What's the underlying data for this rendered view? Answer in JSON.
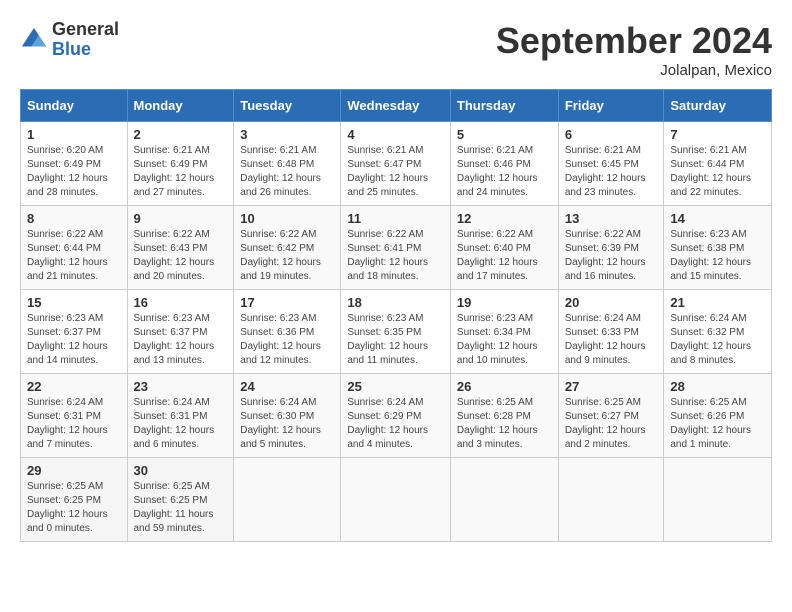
{
  "logo": {
    "general": "General",
    "blue": "Blue"
  },
  "title": "September 2024",
  "location": "Jolalpan, Mexico",
  "days_header": [
    "Sunday",
    "Monday",
    "Tuesday",
    "Wednesday",
    "Thursday",
    "Friday",
    "Saturday"
  ],
  "weeks": [
    [
      {
        "day": "1",
        "sunrise": "6:20 AM",
        "sunset": "6:49 PM",
        "daylight": "12 hours and 28 minutes."
      },
      {
        "day": "2",
        "sunrise": "6:21 AM",
        "sunset": "6:49 PM",
        "daylight": "12 hours and 27 minutes."
      },
      {
        "day": "3",
        "sunrise": "6:21 AM",
        "sunset": "6:48 PM",
        "daylight": "12 hours and 26 minutes."
      },
      {
        "day": "4",
        "sunrise": "6:21 AM",
        "sunset": "6:47 PM",
        "daylight": "12 hours and 25 minutes."
      },
      {
        "day": "5",
        "sunrise": "6:21 AM",
        "sunset": "6:46 PM",
        "daylight": "12 hours and 24 minutes."
      },
      {
        "day": "6",
        "sunrise": "6:21 AM",
        "sunset": "6:45 PM",
        "daylight": "12 hours and 23 minutes."
      },
      {
        "day": "7",
        "sunrise": "6:21 AM",
        "sunset": "6:44 PM",
        "daylight": "12 hours and 22 minutes."
      }
    ],
    [
      {
        "day": "8",
        "sunrise": "6:22 AM",
        "sunset": "6:44 PM",
        "daylight": "12 hours and 21 minutes."
      },
      {
        "day": "9",
        "sunrise": "6:22 AM",
        "sunset": "6:43 PM",
        "daylight": "12 hours and 20 minutes."
      },
      {
        "day": "10",
        "sunrise": "6:22 AM",
        "sunset": "6:42 PM",
        "daylight": "12 hours and 19 minutes."
      },
      {
        "day": "11",
        "sunrise": "6:22 AM",
        "sunset": "6:41 PM",
        "daylight": "12 hours and 18 minutes."
      },
      {
        "day": "12",
        "sunrise": "6:22 AM",
        "sunset": "6:40 PM",
        "daylight": "12 hours and 17 minutes."
      },
      {
        "day": "13",
        "sunrise": "6:22 AM",
        "sunset": "6:39 PM",
        "daylight": "12 hours and 16 minutes."
      },
      {
        "day": "14",
        "sunrise": "6:23 AM",
        "sunset": "6:38 PM",
        "daylight": "12 hours and 15 minutes."
      }
    ],
    [
      {
        "day": "15",
        "sunrise": "6:23 AM",
        "sunset": "6:37 PM",
        "daylight": "12 hours and 14 minutes."
      },
      {
        "day": "16",
        "sunrise": "6:23 AM",
        "sunset": "6:37 PM",
        "daylight": "12 hours and 13 minutes."
      },
      {
        "day": "17",
        "sunrise": "6:23 AM",
        "sunset": "6:36 PM",
        "daylight": "12 hours and 12 minutes."
      },
      {
        "day": "18",
        "sunrise": "6:23 AM",
        "sunset": "6:35 PM",
        "daylight": "12 hours and 11 minutes."
      },
      {
        "day": "19",
        "sunrise": "6:23 AM",
        "sunset": "6:34 PM",
        "daylight": "12 hours and 10 minutes."
      },
      {
        "day": "20",
        "sunrise": "6:24 AM",
        "sunset": "6:33 PM",
        "daylight": "12 hours and 9 minutes."
      },
      {
        "day": "21",
        "sunrise": "6:24 AM",
        "sunset": "6:32 PM",
        "daylight": "12 hours and 8 minutes."
      }
    ],
    [
      {
        "day": "22",
        "sunrise": "6:24 AM",
        "sunset": "6:31 PM",
        "daylight": "12 hours and 7 minutes."
      },
      {
        "day": "23",
        "sunrise": "6:24 AM",
        "sunset": "6:31 PM",
        "daylight": "12 hours and 6 minutes."
      },
      {
        "day": "24",
        "sunrise": "6:24 AM",
        "sunset": "6:30 PM",
        "daylight": "12 hours and 5 minutes."
      },
      {
        "day": "25",
        "sunrise": "6:24 AM",
        "sunset": "6:29 PM",
        "daylight": "12 hours and 4 minutes."
      },
      {
        "day": "26",
        "sunrise": "6:25 AM",
        "sunset": "6:28 PM",
        "daylight": "12 hours and 3 minutes."
      },
      {
        "day": "27",
        "sunrise": "6:25 AM",
        "sunset": "6:27 PM",
        "daylight": "12 hours and 2 minutes."
      },
      {
        "day": "28",
        "sunrise": "6:25 AM",
        "sunset": "6:26 PM",
        "daylight": "12 hours and 1 minute."
      }
    ],
    [
      {
        "day": "29",
        "sunrise": "6:25 AM",
        "sunset": "6:25 PM",
        "daylight": "12 hours and 0 minutes."
      },
      {
        "day": "30",
        "sunrise": "6:25 AM",
        "sunset": "6:25 PM",
        "daylight": "11 hours and 59 minutes."
      },
      null,
      null,
      null,
      null,
      null
    ]
  ],
  "labels": {
    "sunrise": "Sunrise:",
    "sunset": "Sunset:",
    "daylight": "Daylight:"
  }
}
